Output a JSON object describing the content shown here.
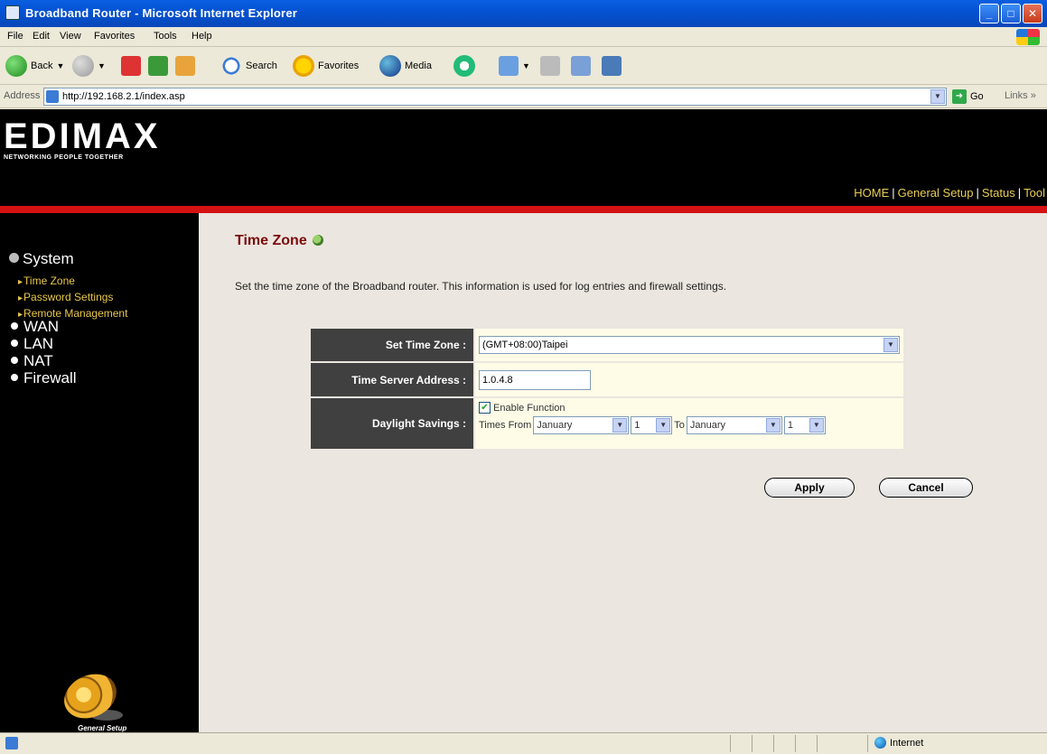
{
  "window": {
    "title": "Broadband Router - Microsoft Internet Explorer",
    "minimize": "_",
    "maximize": "□",
    "close": "✕"
  },
  "menubar": [
    "File",
    "Edit",
    "View",
    "Favorites",
    "Tools",
    "Help"
  ],
  "toolbar": {
    "back": "Back",
    "search": "Search",
    "favorites": "Favorites",
    "media": "Media"
  },
  "address": {
    "label": "Address",
    "url": "http://192.168.2.1/index.asp",
    "go": "Go",
    "links": "Links »"
  },
  "banner": {
    "logo_word_a": "EDI",
    "logo_word_b": "MAX",
    "tagline": "NETWORKING PEOPLE TOGETHER"
  },
  "topnav": [
    "HOME",
    "General Setup",
    "Status",
    "Tool"
  ],
  "sidebar": {
    "system": "System",
    "sub_items": [
      "Time Zone",
      "Password Settings",
      "Remote Management"
    ],
    "main_items": [
      "WAN",
      "LAN",
      "NAT",
      "Firewall"
    ],
    "caption": "General Setup"
  },
  "page": {
    "title": "Time Zone",
    "description": "Set the time zone of the Broadband router. This information is used for log entries and firewall settings."
  },
  "form": {
    "time_zone_label": "Set Time Zone :",
    "time_zone_value": "(GMT+08:00)Taipei",
    "server_label": "Time Server Address :",
    "server_value": "1.0.4.8",
    "daylight_label": "Daylight Savings :",
    "enable_label": "Enable Function",
    "enable_checked": true,
    "times_from_label": "Times From",
    "from_month": "January",
    "from_day": "1",
    "to_label": "To",
    "to_month": "January",
    "to_day": "1"
  },
  "buttons": {
    "apply": "Apply",
    "cancel": "Cancel"
  },
  "status": {
    "zone": "Internet"
  },
  "colors": {
    "accent_red": "#d41212",
    "nav_gold": "#e8ce52",
    "title_maroon": "#7b0a0a"
  }
}
